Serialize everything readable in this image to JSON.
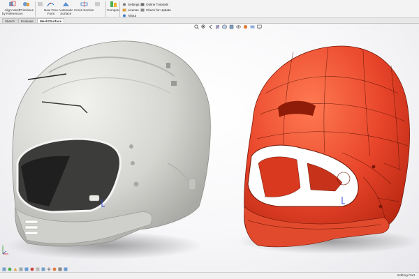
{
  "ribbon": {
    "align_mesh_label_1": "Align Mesh",
    "align_mesh_label_2": "by References",
    "primitives_label": "Primitives",
    "new_free_form_label_1": "New Free",
    "new_free_form_label_2": "Form",
    "automatic_surface_label_1": "Automatic",
    "automatic_surface_label_2": "Surface",
    "cross_section_label": "Cross Section",
    "compare_label": "Compare",
    "settings_label": "Settings",
    "license_label": "License",
    "about_label": "About",
    "online_tutorials_label": "Online Tutorials",
    "check_update_label": "Check for Update"
  },
  "tabs": [
    {
      "label": "Sketch"
    },
    {
      "label": "Evaluate"
    },
    {
      "label": "Mesh2Surface"
    }
  ],
  "status": {
    "text": "Editing Part"
  },
  "colors": {
    "mesh_helmet": "#d9dad5",
    "surface_helmet": "#e8452a",
    "ribbon_bg": "#f3f3f3"
  }
}
